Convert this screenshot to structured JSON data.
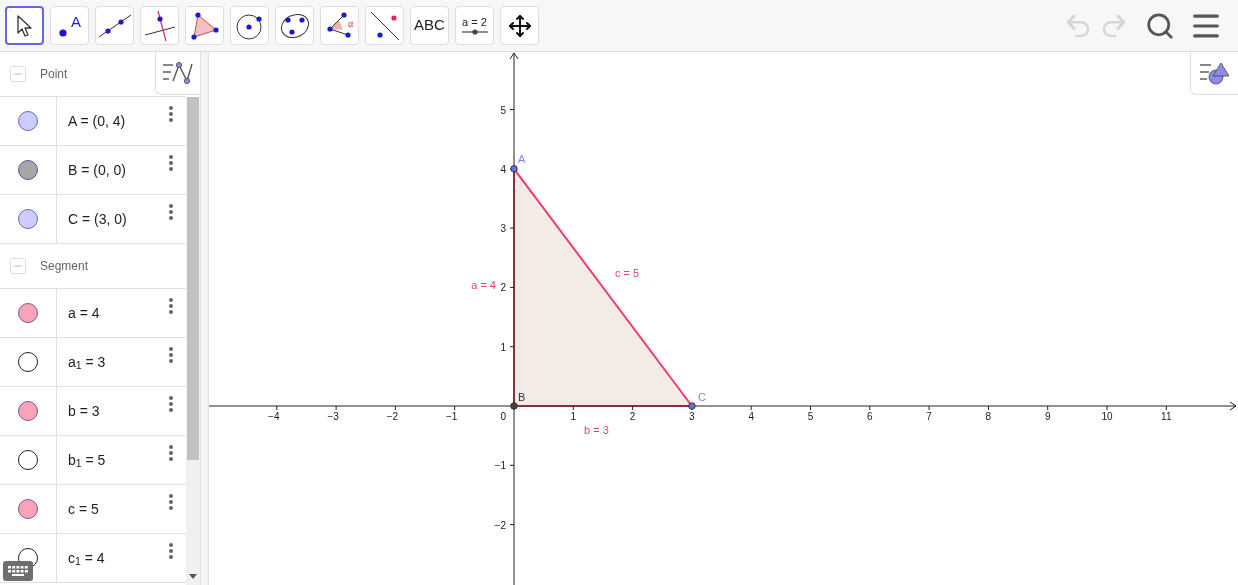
{
  "toolbar": {
    "tools": [
      {
        "kind": "move",
        "selected": true
      },
      {
        "kind": "point",
        "label": "A",
        "selected": false
      },
      {
        "kind": "line",
        "selected": false
      },
      {
        "kind": "perpendicular",
        "selected": false
      },
      {
        "kind": "polygon",
        "selected": false
      },
      {
        "kind": "circle",
        "selected": false
      },
      {
        "kind": "conic",
        "selected": false
      },
      {
        "kind": "angle",
        "label": "α",
        "selected": false
      },
      {
        "kind": "reflect",
        "selected": false
      },
      {
        "kind": "text",
        "label": "ABC",
        "selected": false
      },
      {
        "kind": "slider",
        "label": "a = 2",
        "selected": false
      },
      {
        "kind": "pan",
        "selected": false
      }
    ],
    "undo": {
      "disabled": true
    },
    "redo": {
      "disabled": true
    }
  },
  "algebra": {
    "groups": [
      {
        "title": "Point",
        "expanded": true,
        "items": [
          {
            "text": "A = (0, 4)",
            "visible": true,
            "color": "#ccccff"
          },
          {
            "text": "B = (0, 0)",
            "visible": true,
            "color": "#a6a6a6"
          },
          {
            "text": "C = (3, 0)",
            "visible": true,
            "color": "#ccccff"
          }
        ]
      },
      {
        "title": "Segment",
        "expanded": true,
        "items": [
          {
            "text": "a = 4",
            "visible": true,
            "color": "#f9a3b8"
          },
          {
            "text": "a$_{1}$ = 3",
            "visible": false
          },
          {
            "text": "b = 3",
            "visible": true,
            "color": "#f9a3b8"
          },
          {
            "text": "b$_{1}$ = 5",
            "visible": false
          },
          {
            "text": "c = 5",
            "visible": true,
            "color": "#f9a3b8"
          },
          {
            "text": "c$_{1}$ = 4",
            "visible": false
          }
        ]
      }
    ]
  },
  "graphics": {
    "x_ticks": [
      "−4",
      "−3",
      "−2",
      "−1",
      "1",
      "2",
      "3",
      "4",
      "5",
      "6",
      "7",
      "8",
      "9",
      "10",
      "11"
    ],
    "y_ticks": [
      "5",
      "4",
      "3",
      "2",
      "1",
      "−1",
      "−2"
    ],
    "origin_label": "0",
    "points": [
      {
        "label": "A",
        "color": "#6b6bdc"
      },
      {
        "label": "B",
        "color": "#444444"
      },
      {
        "label": "C",
        "color": "#6b6bdc"
      }
    ],
    "segment_labels": [
      "a = 4",
      "b = 3",
      "c = 5"
    ]
  }
}
